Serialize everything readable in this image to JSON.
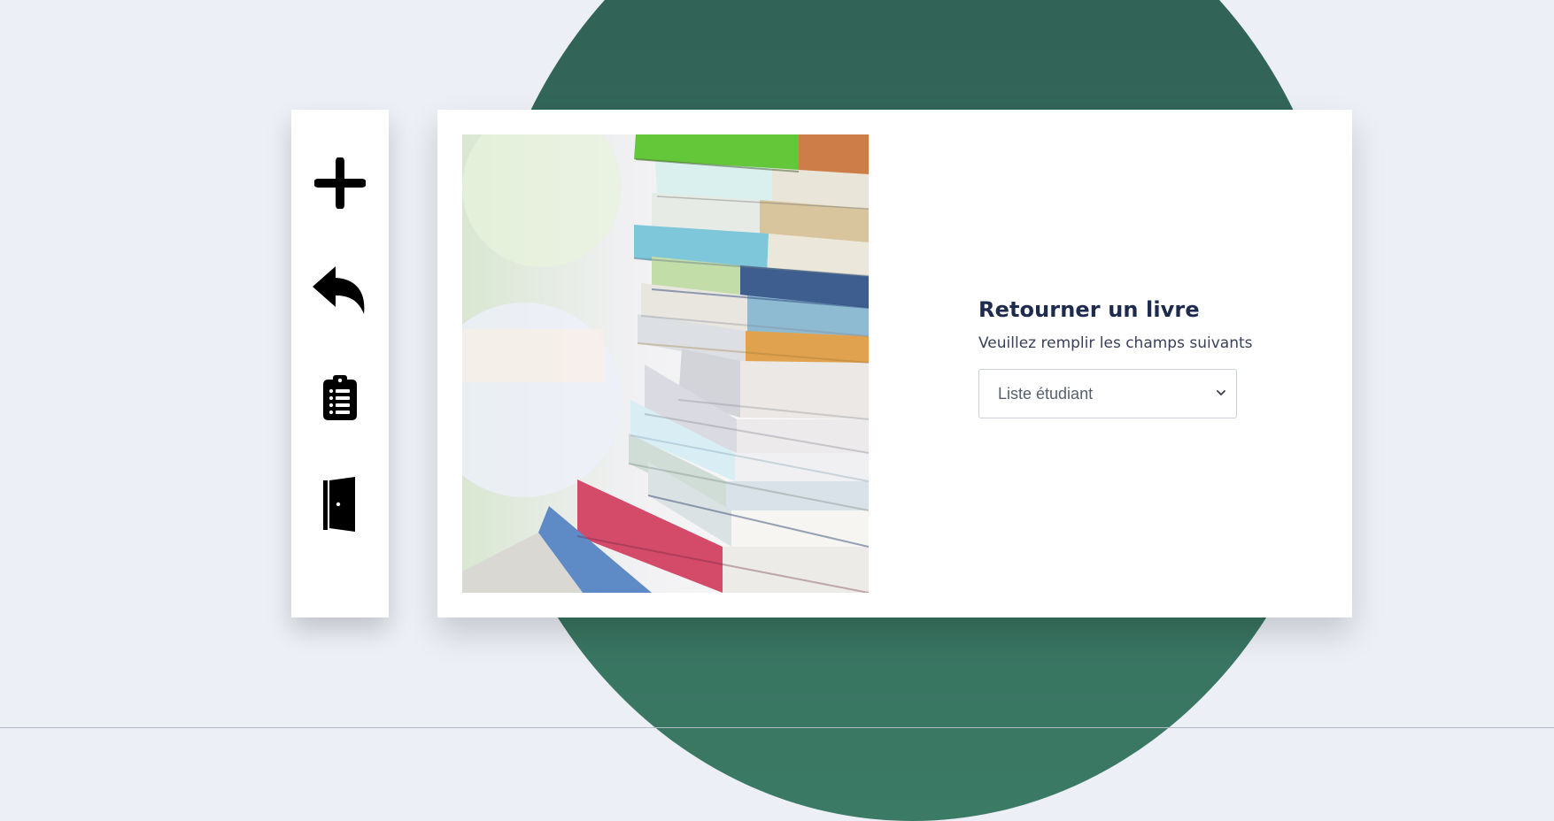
{
  "icons": {
    "add": "plus-icon",
    "return": "reply-icon",
    "list": "clipboard-list-icon",
    "logout": "door-open-icon",
    "hero": "book-stack-image",
    "dropdown": "chevron-down-icon"
  },
  "sidebar": {
    "items": [
      {
        "name": "add"
      },
      {
        "name": "return"
      },
      {
        "name": "list"
      },
      {
        "name": "logout"
      }
    ]
  },
  "form": {
    "title": "Retourner un livre",
    "subtitle": "Veuillez remplir les champs suivants",
    "select": {
      "selected": "Liste étudiant",
      "options": [
        "Liste étudiant"
      ]
    }
  },
  "colors": {
    "background": "#eceff6",
    "accent_green": "#2f5f53",
    "card": "#ffffff",
    "heading": "#1e2b4d",
    "text": "#39405a",
    "select_border": "#cbcfd8"
  }
}
